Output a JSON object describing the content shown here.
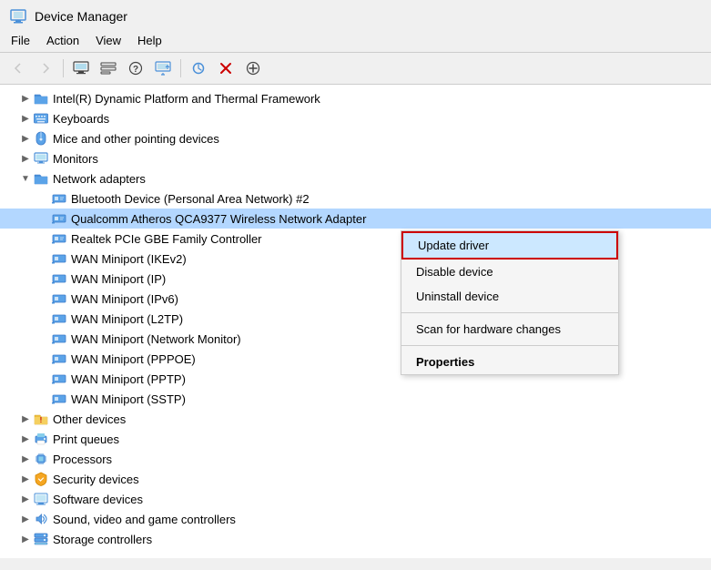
{
  "window": {
    "title": "Device Manager",
    "icon": "device-manager-icon"
  },
  "menubar": {
    "items": [
      {
        "label": "File",
        "id": "menu-file"
      },
      {
        "label": "Action",
        "id": "menu-action"
      },
      {
        "label": "View",
        "id": "menu-view"
      },
      {
        "label": "Help",
        "id": "menu-help"
      }
    ]
  },
  "toolbar": {
    "buttons": [
      {
        "name": "back-btn",
        "icon": "←",
        "disabled": false
      },
      {
        "name": "forward-btn",
        "icon": "→",
        "disabled": false
      },
      {
        "name": "computer-btn",
        "icon": "🖥",
        "disabled": false
      },
      {
        "name": "show-hidden-btn",
        "icon": "📄",
        "disabled": false
      },
      {
        "name": "help-btn",
        "icon": "?",
        "disabled": false
      },
      {
        "name": "update-driver-btn",
        "icon": "🖥",
        "disabled": false
      },
      {
        "name": "scan-btn",
        "icon": "🔍",
        "disabled": false
      },
      {
        "name": "disable-btn",
        "icon": "✖",
        "disabled": false
      },
      {
        "name": "install-btn",
        "icon": "⊕",
        "disabled": false
      }
    ]
  },
  "tree": {
    "items": [
      {
        "id": "intel-dynamic",
        "label": "Intel(R) Dynamic Platform and Thermal Framework",
        "indent": 1,
        "expanded": false,
        "icon": "folder",
        "hasExpand": true
      },
      {
        "id": "keyboards",
        "label": "Keyboards",
        "indent": 1,
        "expanded": false,
        "icon": "keyboard",
        "hasExpand": true
      },
      {
        "id": "mice",
        "label": "Mice and other pointing devices",
        "indent": 1,
        "expanded": false,
        "icon": "mouse",
        "hasExpand": true
      },
      {
        "id": "monitors",
        "label": "Monitors",
        "indent": 1,
        "expanded": false,
        "icon": "monitor",
        "hasExpand": true
      },
      {
        "id": "network-adapters",
        "label": "Network adapters",
        "indent": 1,
        "expanded": true,
        "icon": "network",
        "hasExpand": true
      },
      {
        "id": "bluetooth",
        "label": "Bluetooth Device (Personal Area Network) #2",
        "indent": 2,
        "expanded": false,
        "icon": "network-card",
        "hasExpand": false
      },
      {
        "id": "qualcomm",
        "label": "Qualcomm Atheros QCA9377 Wireless Network Adapter",
        "indent": 2,
        "expanded": false,
        "icon": "network-card",
        "selected": true,
        "hasExpand": false
      },
      {
        "id": "realtek",
        "label": "Realtek PCIe GBE Family Controller",
        "indent": 2,
        "expanded": false,
        "icon": "network-card",
        "hasExpand": false
      },
      {
        "id": "wan-ikev2",
        "label": "WAN Miniport (IKEv2)",
        "indent": 2,
        "expanded": false,
        "icon": "network-card",
        "hasExpand": false
      },
      {
        "id": "wan-ip",
        "label": "WAN Miniport (IP)",
        "indent": 2,
        "expanded": false,
        "icon": "network-card",
        "hasExpand": false
      },
      {
        "id": "wan-ipv6",
        "label": "WAN Miniport (IPv6)",
        "indent": 2,
        "expanded": false,
        "icon": "network-card",
        "hasExpand": false
      },
      {
        "id": "wan-l2tp",
        "label": "WAN Miniport (L2TP)",
        "indent": 2,
        "expanded": false,
        "icon": "network-card",
        "hasExpand": false
      },
      {
        "id": "wan-netmon",
        "label": "WAN Miniport (Network Monitor)",
        "indent": 2,
        "expanded": false,
        "icon": "network-card",
        "hasExpand": false
      },
      {
        "id": "wan-pppoe",
        "label": "WAN Miniport (PPPOE)",
        "indent": 2,
        "expanded": false,
        "icon": "network-card",
        "hasExpand": false
      },
      {
        "id": "wan-pptp",
        "label": "WAN Miniport (PPTP)",
        "indent": 2,
        "expanded": false,
        "icon": "network-card",
        "hasExpand": false
      },
      {
        "id": "wan-sstp",
        "label": "WAN Miniport (SSTP)",
        "indent": 2,
        "expanded": false,
        "icon": "network-card",
        "hasExpand": false
      },
      {
        "id": "other-devices",
        "label": "Other devices",
        "indent": 1,
        "expanded": false,
        "icon": "warning-folder",
        "hasExpand": true
      },
      {
        "id": "print-queues",
        "label": "Print queues",
        "indent": 1,
        "expanded": false,
        "icon": "printer",
        "hasExpand": true
      },
      {
        "id": "processors",
        "label": "Processors",
        "indent": 1,
        "expanded": false,
        "icon": "processor",
        "hasExpand": true
      },
      {
        "id": "security-devices",
        "label": "Security devices",
        "indent": 1,
        "expanded": false,
        "icon": "security",
        "hasExpand": true
      },
      {
        "id": "software-devices",
        "label": "Software devices",
        "indent": 1,
        "expanded": false,
        "icon": "software",
        "hasExpand": true
      },
      {
        "id": "sound-video",
        "label": "Sound, video and game controllers",
        "indent": 1,
        "expanded": false,
        "icon": "sound",
        "hasExpand": true
      },
      {
        "id": "storage-controllers",
        "label": "Storage controllers",
        "indent": 1,
        "expanded": false,
        "icon": "storage",
        "hasExpand": true
      }
    ]
  },
  "context_menu": {
    "visible": true,
    "items": [
      {
        "id": "update-driver",
        "label": "Update driver",
        "active": true,
        "bold": false,
        "divider_after": false
      },
      {
        "id": "disable-device",
        "label": "Disable device",
        "active": false,
        "bold": false,
        "divider_after": false
      },
      {
        "id": "uninstall-device",
        "label": "Uninstall device",
        "active": false,
        "bold": false,
        "divider_after": true
      },
      {
        "id": "scan-hardware",
        "label": "Scan for hardware changes",
        "active": false,
        "bold": false,
        "divider_after": true
      },
      {
        "id": "properties",
        "label": "Properties",
        "active": false,
        "bold": true,
        "divider_after": false
      }
    ]
  }
}
